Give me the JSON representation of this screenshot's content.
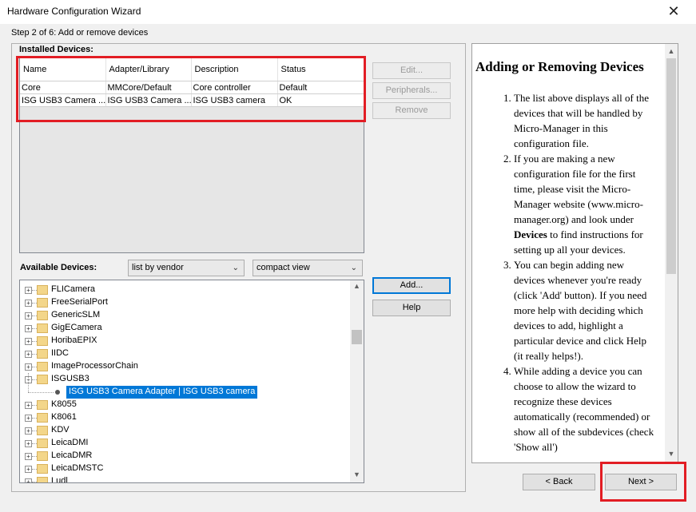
{
  "window": {
    "title": "Hardware Configuration Wizard",
    "close_glyph": "✕"
  },
  "step_label": "Step 2 of 6: Add or remove devices",
  "installed": {
    "title": "Installed Devices:",
    "columns": [
      "Name",
      "Adapter/Library",
      "Description",
      "Status"
    ],
    "rows": [
      [
        "Core",
        "MMCore/Default",
        "Core controller",
        "Default"
      ],
      [
        "ISG USB3 Camera ...",
        "ISG USB3 Camera ...",
        "ISG USB3 camera",
        "OK"
      ]
    ],
    "buttons": {
      "edit": "Edit...",
      "peripherals": "Peripherals...",
      "remove": "Remove"
    }
  },
  "available": {
    "label": "Available Devices:",
    "group_by": "list by vendor",
    "view_mode": "compact view",
    "add": "Add...",
    "help": "Help",
    "tree": [
      {
        "label": "FLICamera",
        "expanded": false
      },
      {
        "label": "FreeSerialPort",
        "expanded": false
      },
      {
        "label": "GenericSLM",
        "expanded": false
      },
      {
        "label": "GigECamera",
        "expanded": false
      },
      {
        "label": "HoribaEPIX",
        "expanded": false
      },
      {
        "label": "IIDC",
        "expanded": false
      },
      {
        "label": "ImageProcessorChain",
        "expanded": false
      },
      {
        "label": "ISGUSB3",
        "expanded": true
      },
      {
        "label": "ISG USB3 Camera Adapter | ISG USB3 camera",
        "child": true,
        "selected": true
      },
      {
        "label": "K8055",
        "expanded": false
      },
      {
        "label": "K8061",
        "expanded": false
      },
      {
        "label": "KDV",
        "expanded": false
      },
      {
        "label": "LeicaDMI",
        "expanded": false
      },
      {
        "label": "LeicaDMR",
        "expanded": false
      },
      {
        "label": "LeicaDMSTC",
        "expanded": false
      },
      {
        "label": "Ludl",
        "expanded": false
      }
    ]
  },
  "help_panel": {
    "heading": "Adding or Removing Devices",
    "items": [
      {
        "text": "The list above displays all of the devices that will be handled by Micro-Manager in this configuration file."
      },
      {
        "before": "If you are making a new configuration file for the first time, please visit the Micro-Manager website (www.micro-manager.org) and look under ",
        "bold": "Devices",
        "after": " to find instructions for setting up all your devices."
      },
      {
        "text": "You can begin adding new devices whenever you're ready (click 'Add' button). If you need more help with deciding which devices to add, highlight a particular device and click Help (it really helps!)."
      },
      {
        "text": "While adding a device you can choose to allow the wizard to recognize these devices automatically (recommended) or show all of the subdevices (check 'Show all')"
      }
    ]
  },
  "nav": {
    "back": "< Back",
    "next": "Next >"
  },
  "colors": {
    "highlight_box": "#e21d24",
    "selection": "#0078d7"
  }
}
